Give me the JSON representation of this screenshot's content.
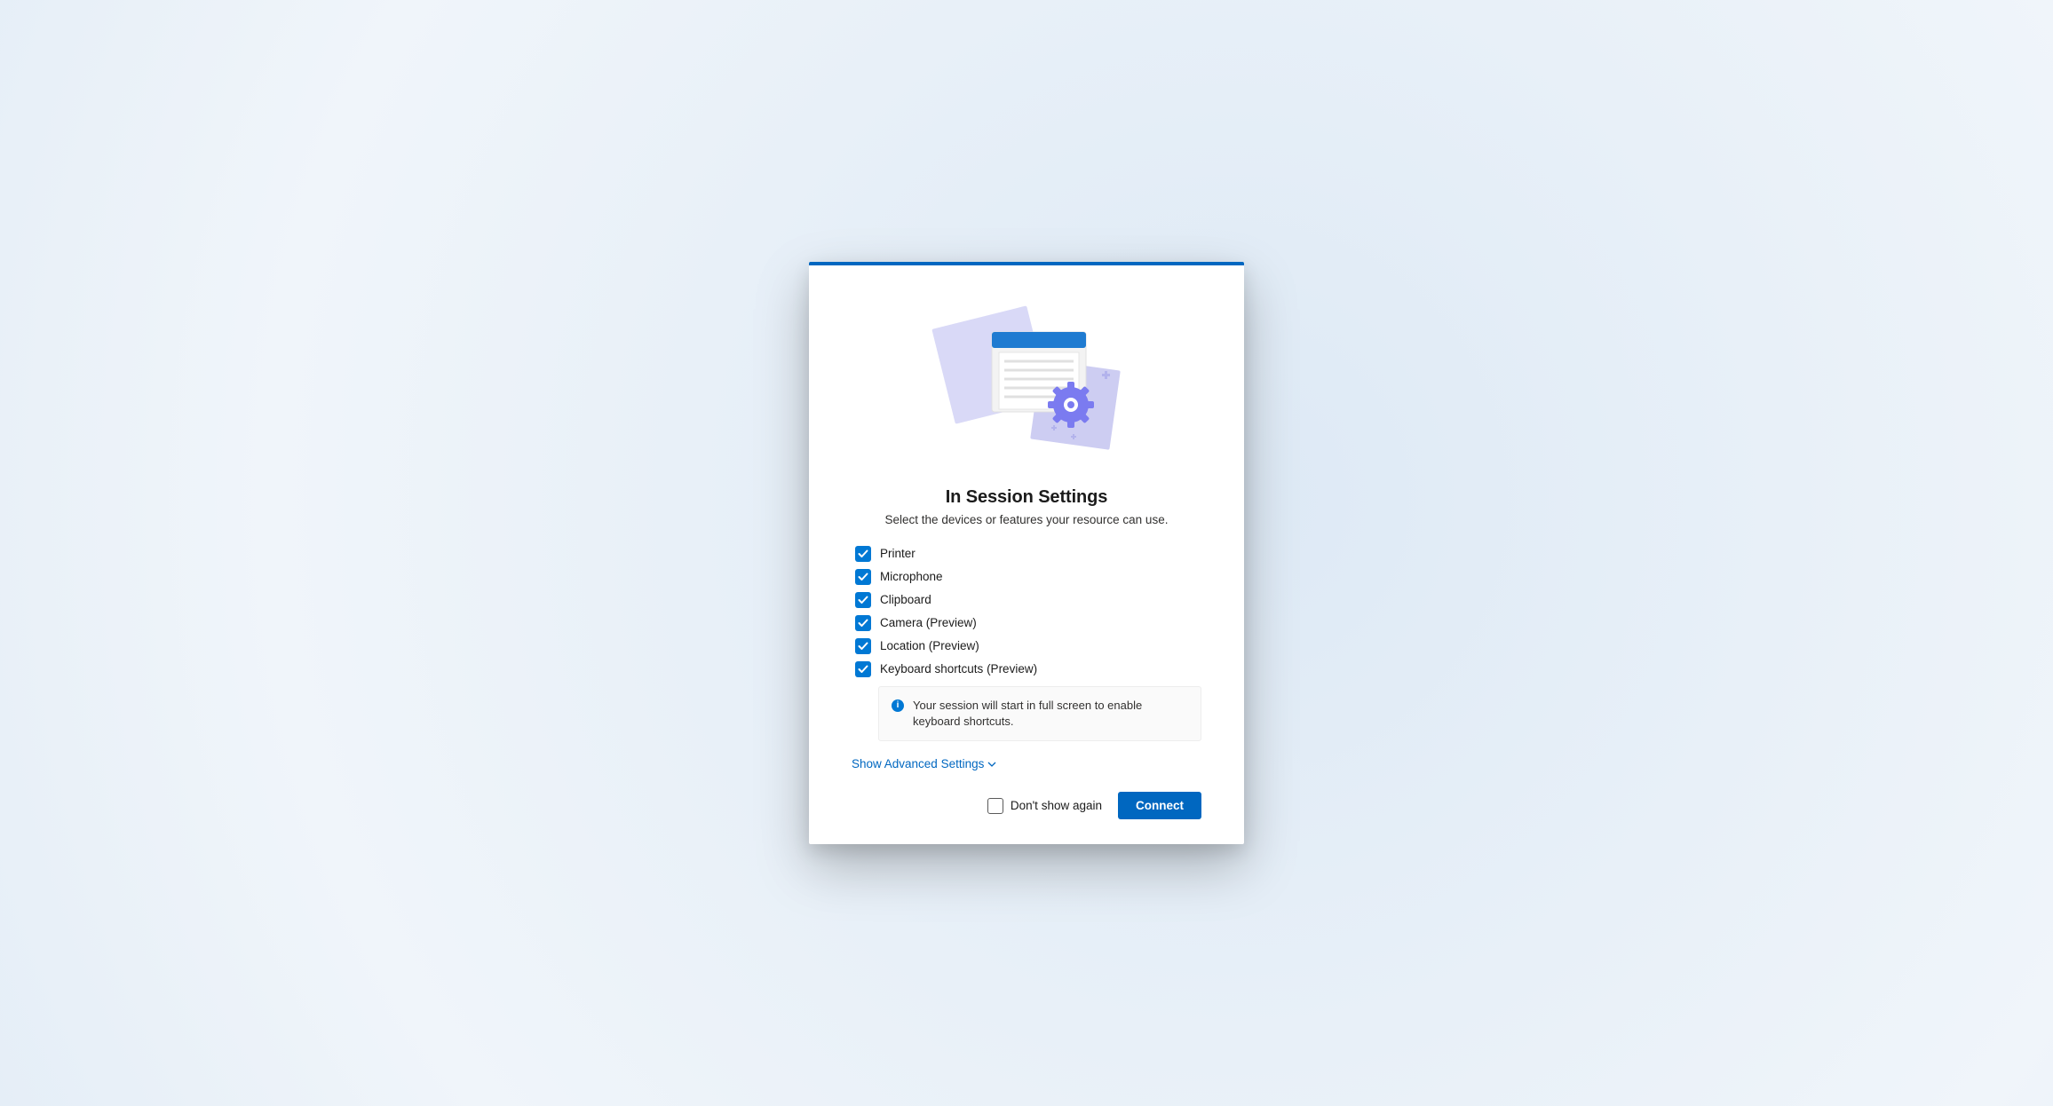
{
  "dialog": {
    "title": "In Session Settings",
    "subtitle": "Select the devices or features your resource can use.",
    "options": [
      {
        "label": "Printer",
        "checked": true
      },
      {
        "label": "Microphone",
        "checked": true
      },
      {
        "label": "Clipboard",
        "checked": true
      },
      {
        "label": "Camera (Preview)",
        "checked": true
      },
      {
        "label": "Location (Preview)",
        "checked": true
      },
      {
        "label": "Keyboard shortcuts (Preview)",
        "checked": true
      }
    ],
    "info_message": "Your session will start in full screen to enable keyboard shortcuts.",
    "advanced_link": "Show Advanced Settings",
    "dont_show_label": "Don't show again",
    "dont_show_checked": false,
    "connect_label": "Connect"
  }
}
